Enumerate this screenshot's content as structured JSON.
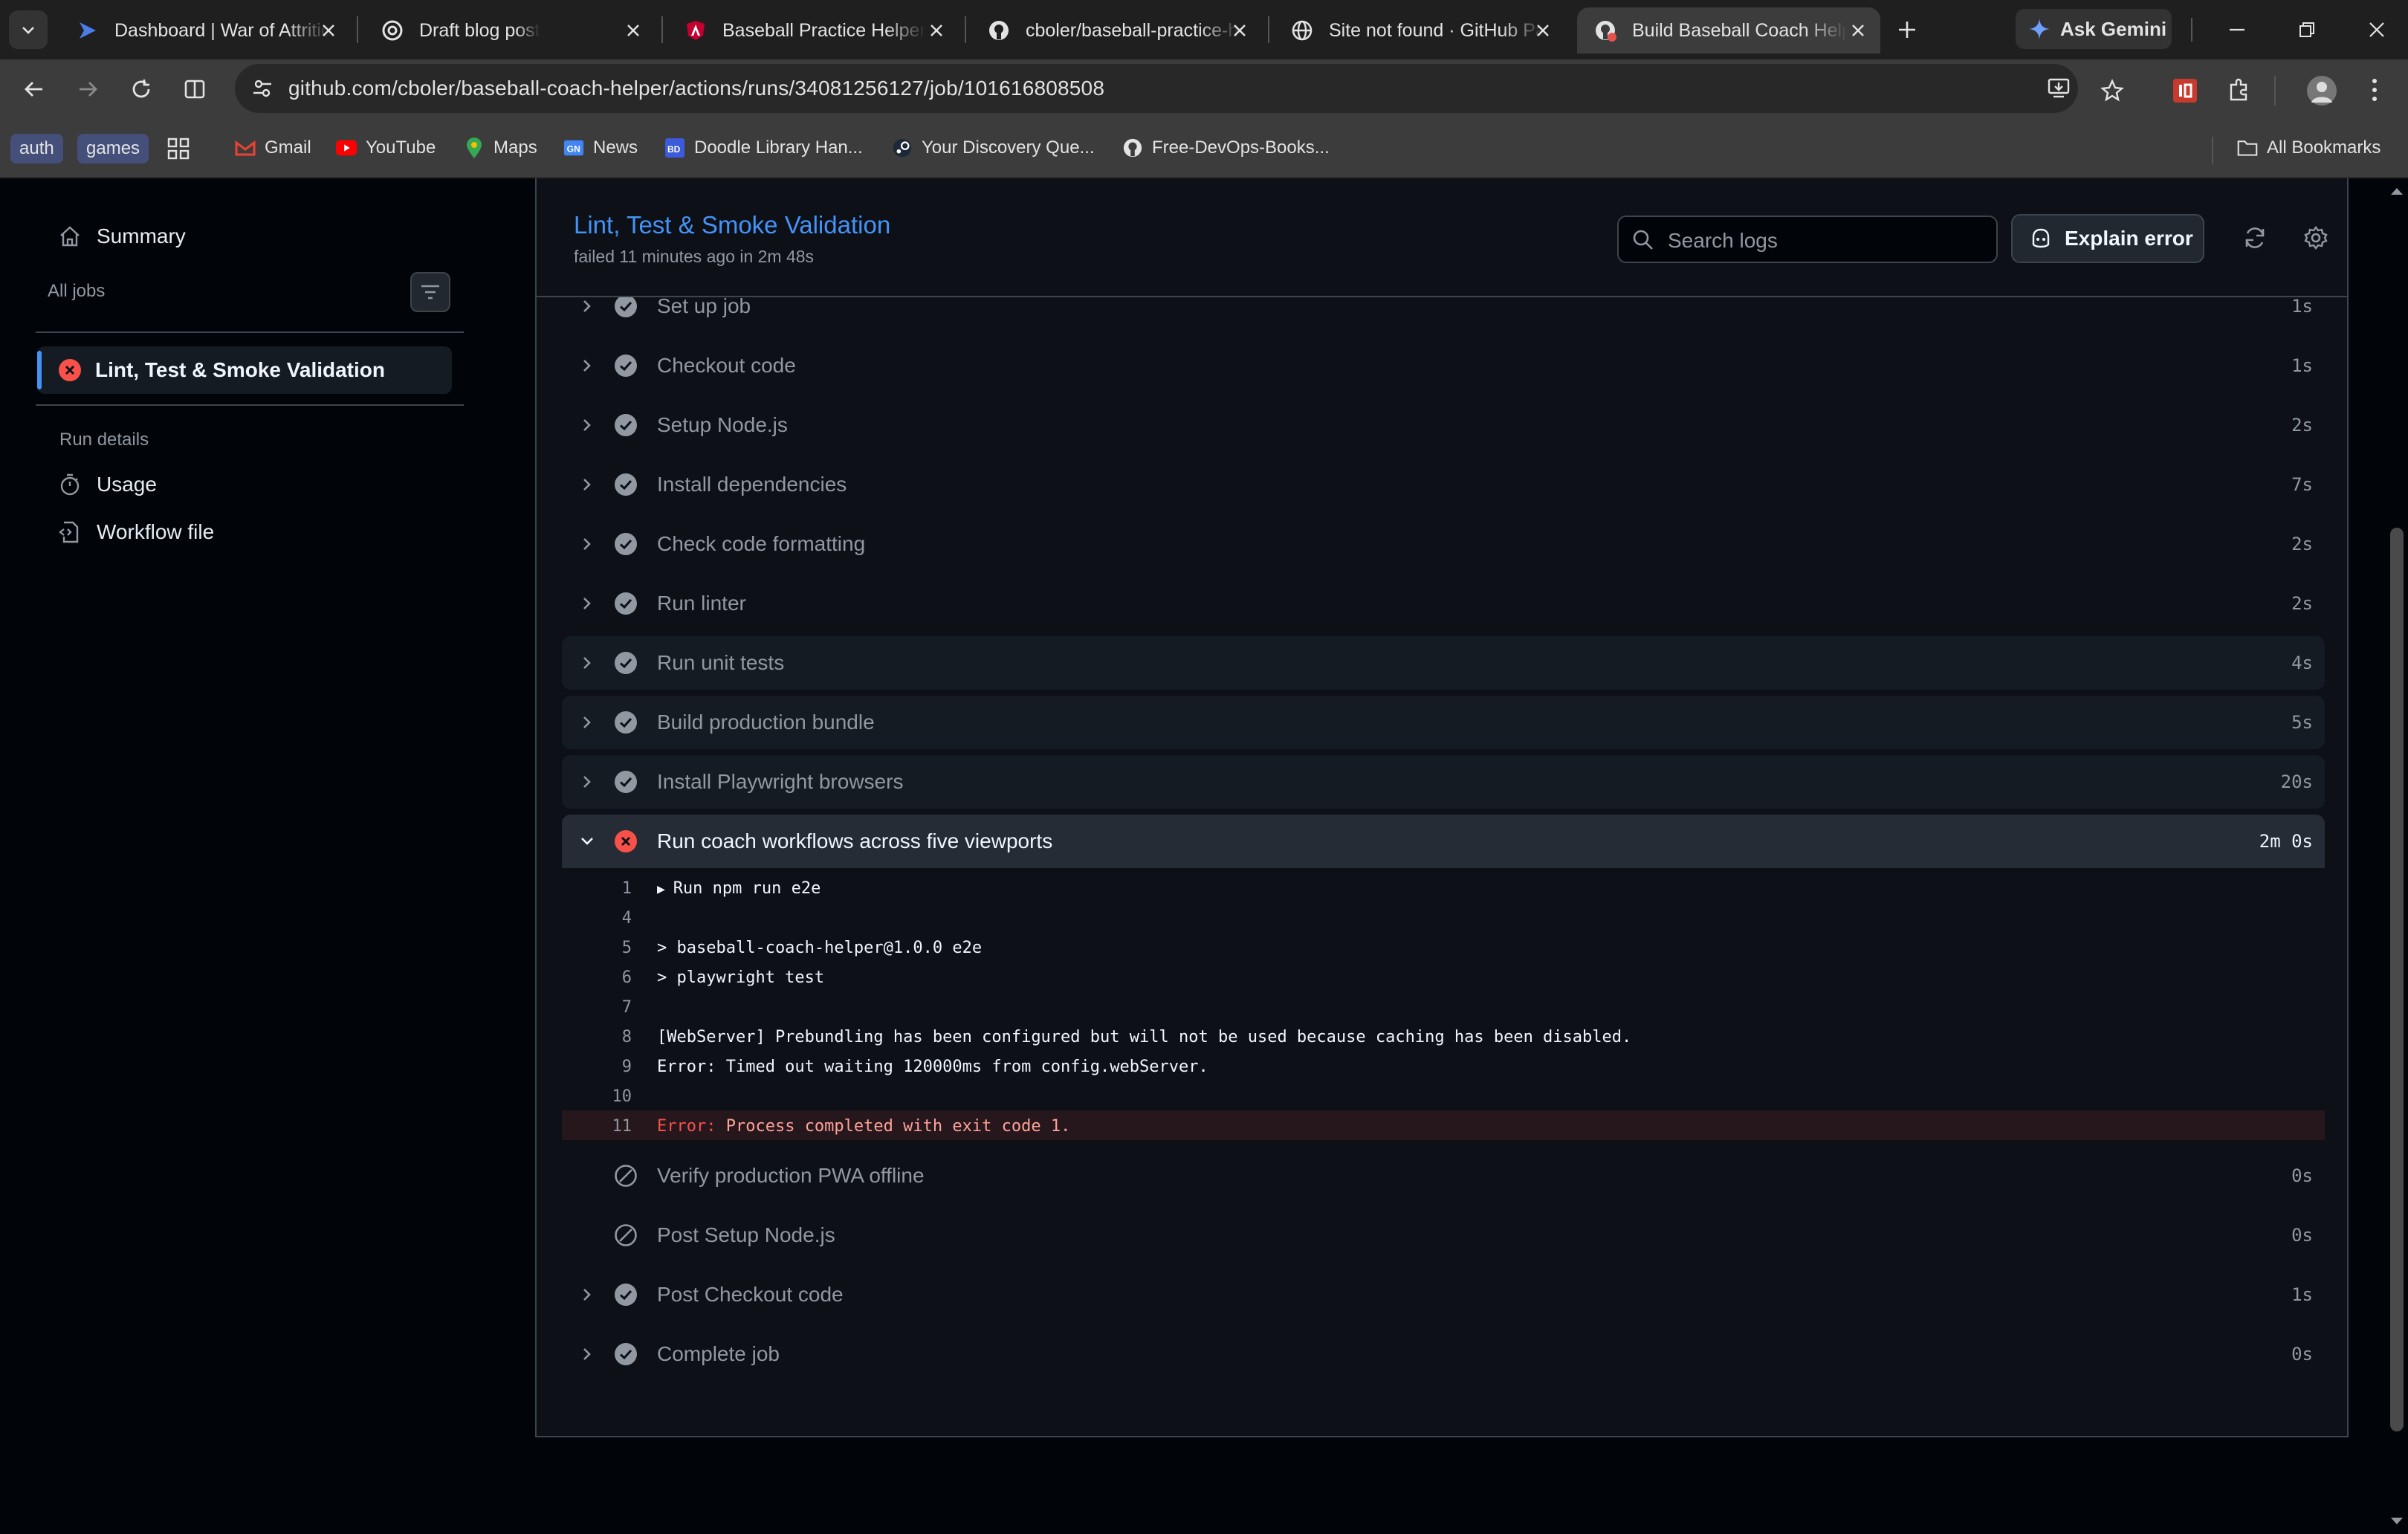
{
  "browser": {
    "tabs": [
      {
        "title": "Dashboard | War of Attrition",
        "icon": "deploy-icon",
        "active": false
      },
      {
        "title": "Draft blog post",
        "icon": "openai-icon",
        "active": false
      },
      {
        "title": "Baseball Practice Helper",
        "icon": "angular-icon",
        "active": false
      },
      {
        "title": "cboler/baseball-practice-helper",
        "icon": "github-icon",
        "active": false
      },
      {
        "title": "Site not found · GitHub Pages",
        "icon": "globe-icon",
        "active": false
      },
      {
        "title": "Build Baseball Coach Helper",
        "icon": "github-icon",
        "active": true
      }
    ],
    "ask_gemini": "Ask Gemini",
    "url": "github.com/cboler/baseball-coach-helper/actions/runs/34081256127/job/101616808508",
    "bookmarks": {
      "chips": [
        "auth",
        "games"
      ],
      "items": [
        {
          "label": "Gmail",
          "icon": "gmail-icon"
        },
        {
          "label": "YouTube",
          "icon": "youtube-icon"
        },
        {
          "label": "Maps",
          "icon": "maps-icon"
        },
        {
          "label": "News",
          "icon": "news-icon"
        },
        {
          "label": "Doodle Library Han...",
          "icon": "doodle-icon"
        },
        {
          "label": "Your Discovery Que...",
          "icon": "steam-icon"
        },
        {
          "label": "Free-DevOps-Books...",
          "icon": "github-icon"
        }
      ],
      "all_bookmarks": "All Bookmarks"
    }
  },
  "sidebar": {
    "summary": "Summary",
    "all_jobs": "All jobs",
    "job": {
      "label": "Lint, Test & Smoke Validation",
      "status": "failed"
    },
    "run_details": "Run details",
    "usage": "Usage",
    "workflow_file": "Workflow file"
  },
  "job": {
    "title": "Lint, Test & Smoke Validation",
    "subtitle": "failed 11 minutes ago in 2m 48s",
    "search_placeholder": "Search logs",
    "explain_error": "Explain error"
  },
  "steps": [
    {
      "name": "Set up job",
      "status": "success",
      "duration": "1s",
      "expandable": true
    },
    {
      "name": "Checkout code",
      "status": "success",
      "duration": "1s",
      "expandable": true
    },
    {
      "name": "Setup Node.js",
      "status": "success",
      "duration": "2s",
      "expandable": true
    },
    {
      "name": "Install dependencies",
      "status": "success",
      "duration": "7s",
      "expandable": true
    },
    {
      "name": "Check code formatting",
      "status": "success",
      "duration": "2s",
      "expandable": true
    },
    {
      "name": "Run linter",
      "status": "success",
      "duration": "2s",
      "expandable": true
    },
    {
      "name": "Run unit tests",
      "status": "success",
      "duration": "4s",
      "expandable": true
    },
    {
      "name": "Build production bundle",
      "status": "success",
      "duration": "5s",
      "expandable": true
    },
    {
      "name": "Install Playwright browsers",
      "status": "success",
      "duration": "20s",
      "expandable": true
    },
    {
      "name": "Run coach workflows across five viewports",
      "status": "failure",
      "duration": "2m 0s",
      "expandable": true,
      "expanded": true
    },
    {
      "name": "Verify production PWA offline",
      "status": "skipped",
      "duration": "0s",
      "expandable": false
    },
    {
      "name": "Post Setup Node.js",
      "status": "skipped",
      "duration": "0s",
      "expandable": false
    },
    {
      "name": "Post Checkout code",
      "status": "success",
      "duration": "1s",
      "expandable": true
    },
    {
      "name": "Complete job",
      "status": "success",
      "duration": "0s",
      "expandable": true
    }
  ],
  "log": [
    {
      "n": "1",
      "text": "Run npm run e2e",
      "group": true
    },
    {
      "n": "4",
      "text": ""
    },
    {
      "n": "5",
      "text": "> baseball-coach-helper@1.0.0 e2e"
    },
    {
      "n": "6",
      "text": "> playwright test"
    },
    {
      "n": "7",
      "text": ""
    },
    {
      "n": "8",
      "text": "[WebServer] Prebundling has been configured but will not be used because caching has been disabled."
    },
    {
      "n": "9",
      "text": "Error: Timed out waiting 120000ms from config.webServer."
    },
    {
      "n": "10",
      "text": ""
    },
    {
      "n": "11",
      "text": "Error: Process completed with exit code 1.",
      "error": true,
      "error_prefix": "Error:",
      "error_rest": " Process completed with exit code 1."
    }
  ],
  "colors": {
    "success": "#9198a1",
    "failure": "#f85149",
    "link": "#4493f8",
    "panel": "#0d1117"
  }
}
